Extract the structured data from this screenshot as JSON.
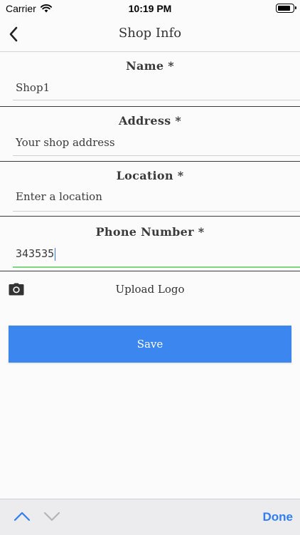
{
  "status_bar": {
    "carrier": "Carrier",
    "time": "10:19 PM"
  },
  "nav": {
    "title": "Shop Info"
  },
  "form": {
    "name": {
      "label": "Name *",
      "value": "Shop1"
    },
    "address": {
      "label": "Address *",
      "placeholder": "Your shop address"
    },
    "location": {
      "label": "Location *",
      "placeholder": "Enter a location"
    },
    "phone": {
      "label": "Phone Number *",
      "value": "343535"
    }
  },
  "upload": {
    "label": "Upload Logo"
  },
  "save": {
    "label": "Save"
  },
  "keyboard_toolbar": {
    "done": "Done"
  },
  "colors": {
    "accent": "#3c86f0",
    "active_underline": "#7ed67e",
    "done": "#2f7df6"
  }
}
